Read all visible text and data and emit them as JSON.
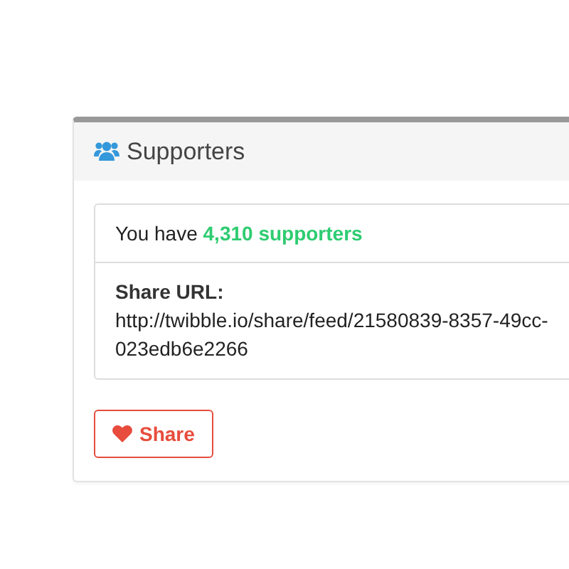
{
  "panel": {
    "title": "Supporters"
  },
  "summary": "You have **4,310 supporters**",
  "share_url": {
    "label": "Share URL:",
    "lines": [
      "http://twibble.io/share/feed/21580839-8357-49cc-",
      "023edb6e2266"
    ]
  },
  "share_button": "Share"
}
